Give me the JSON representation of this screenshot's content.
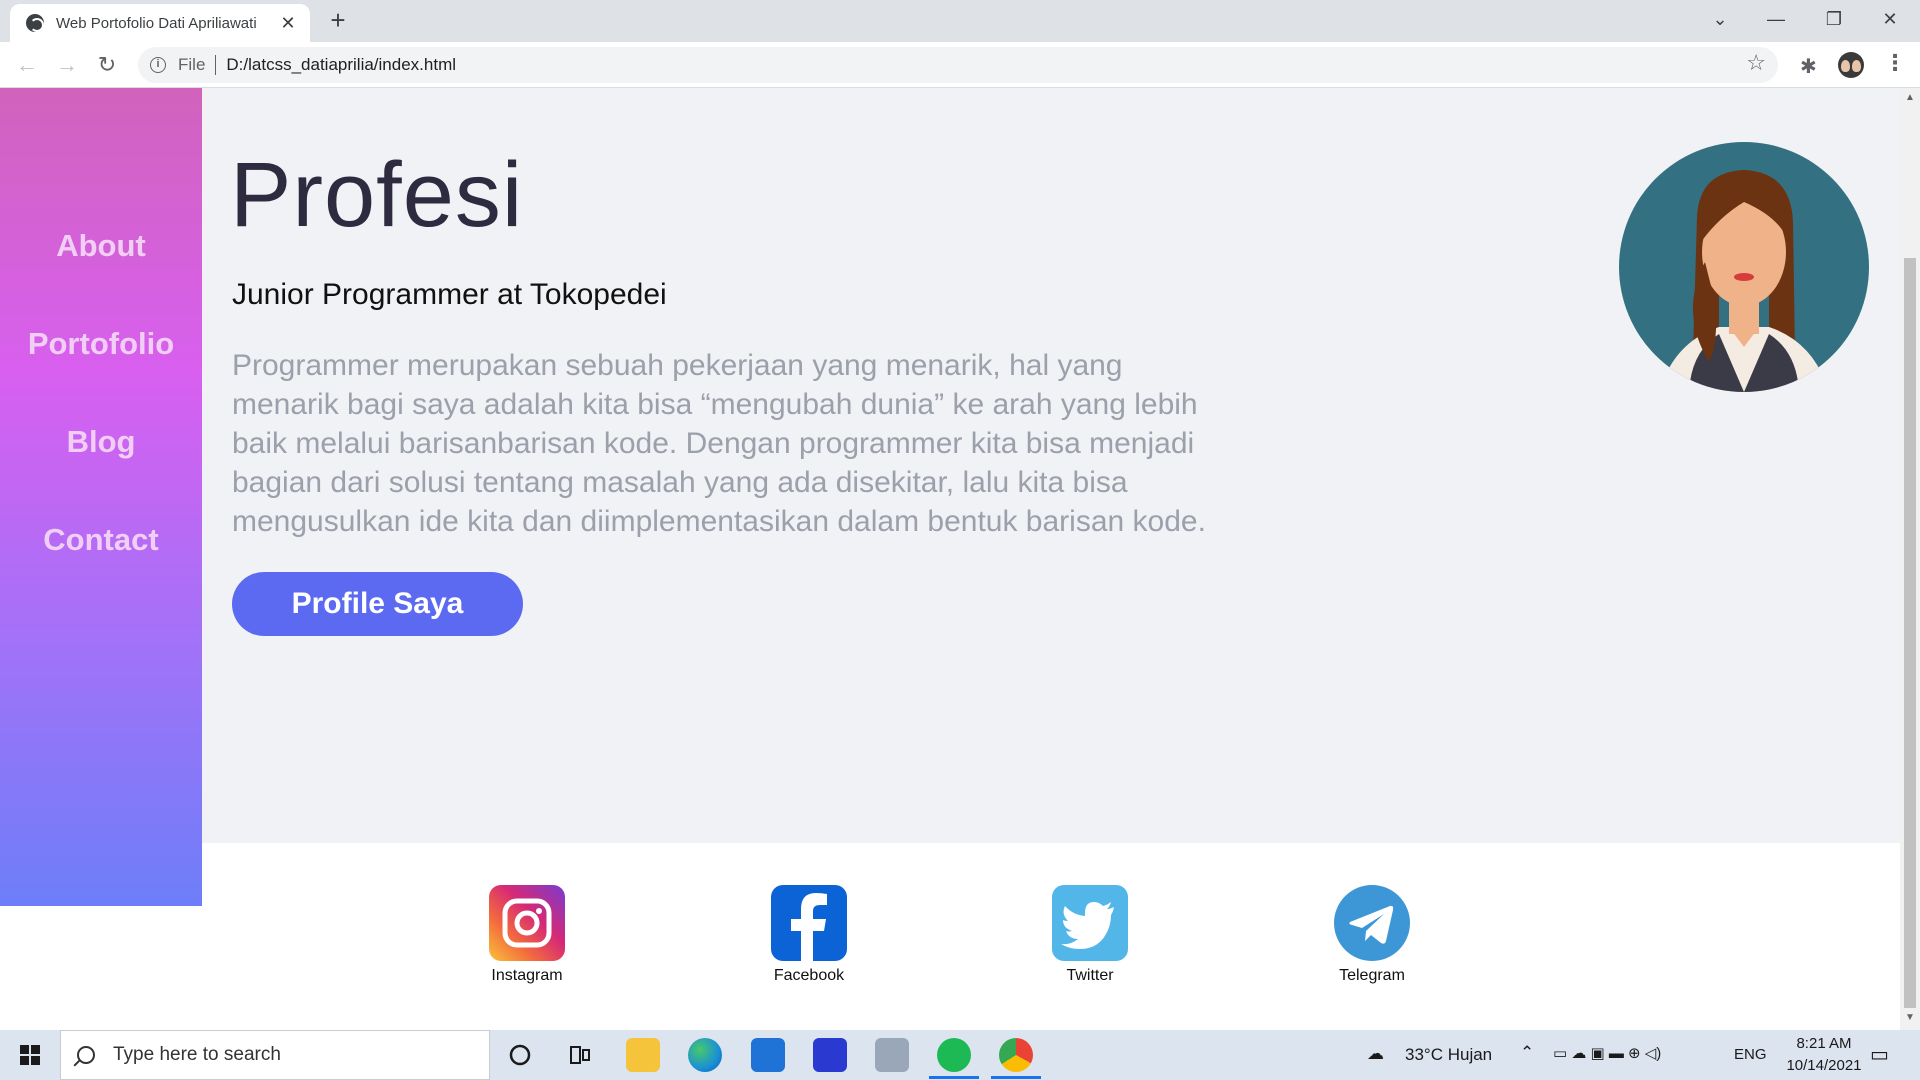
{
  "browser": {
    "tab_title": "Web Portofolio Dati Apriliawati",
    "tab_close": "✕",
    "new_tab": "+",
    "file_label": "File",
    "url": "D:/latcss_datiaprilia/index.html",
    "win_controls": {
      "dropdown": "⌄",
      "minimize": "—",
      "restore": "❐",
      "close": "✕"
    }
  },
  "sidebar": {
    "items": [
      {
        "label": "About"
      },
      {
        "label": "Portofolio"
      },
      {
        "label": "Blog"
      },
      {
        "label": "Contact"
      }
    ]
  },
  "hero": {
    "title": "Profesi",
    "subtitle": "Junior Programmer at Tokopedei",
    "description": "Programmer merupakan sebuah pekerjaan yang menarik, hal yang menarik bagi saya adalah kita bisa “mengubah dunia” ke arah yang lebih baik melalui barisanbarisan kode. Dengan programmer kita bisa menjadi bagian dari solusi tentang masalah yang ada disekitar, lalu kita bisa mengusulkan ide kita dan diimplementasikan dalam bentuk barisan kode.",
    "button_label": "Profile Saya"
  },
  "footer": {
    "socials": [
      {
        "label": "Instagram",
        "icon": "instagram-icon"
      },
      {
        "label": "Facebook",
        "icon": "facebook-icon"
      },
      {
        "label": "Twitter",
        "icon": "twitter-icon"
      },
      {
        "label": "Telegram",
        "icon": "telegram-icon"
      }
    ]
  },
  "taskbar": {
    "search_placeholder": "Type here to search",
    "weather": "33°C  Hujan",
    "language": "ENG",
    "time": "8:21 AM",
    "date": "10/14/2021"
  },
  "colors": {
    "sidebar_gradient": [
      "#d163bc",
      "#d85ff0",
      "#9e73f8",
      "#6d7ef8"
    ],
    "button": "#5b6af0",
    "title": "#2e2a3f",
    "description": "#9ba0aa",
    "portrait_bg": "#337082"
  }
}
